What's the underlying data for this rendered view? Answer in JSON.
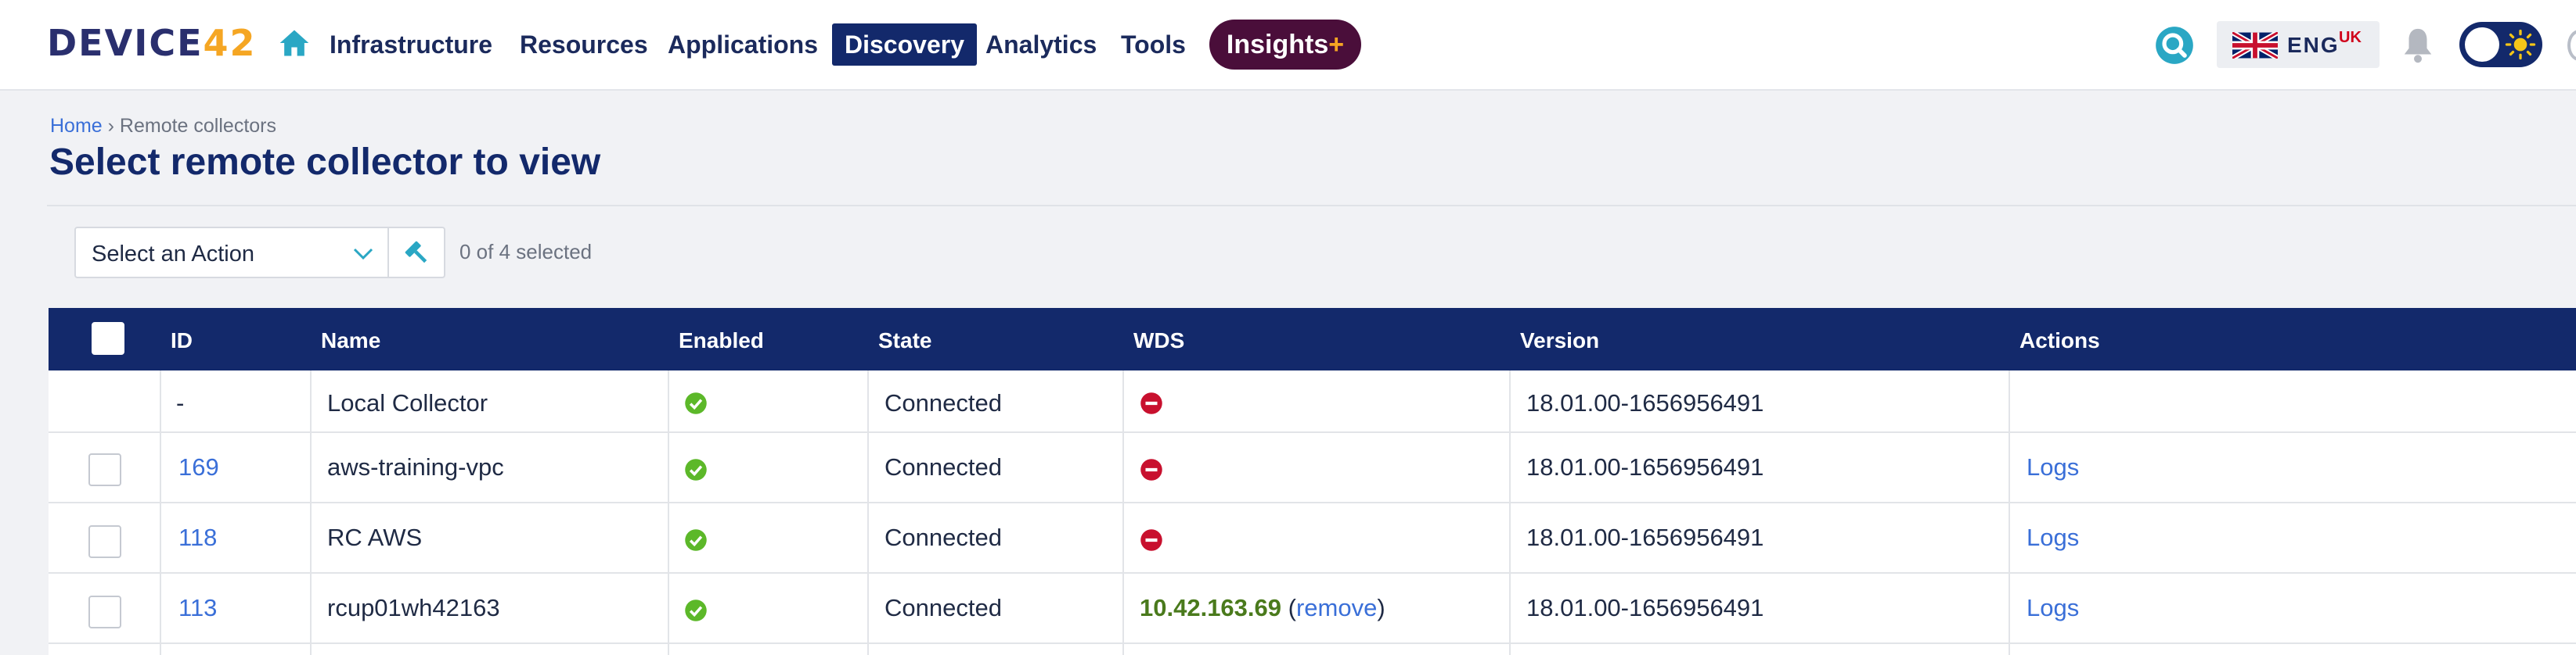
{
  "nav": {
    "logo_prefix": "DEVICE",
    "logo_number": "42",
    "items": [
      {
        "label": "Infrastructure"
      },
      {
        "label": "Resources"
      },
      {
        "label": "Applications"
      },
      {
        "label": "Discovery"
      },
      {
        "label": "Analytics"
      },
      {
        "label": "Tools"
      }
    ],
    "insights_label": "Insights",
    "insights_plus": "+",
    "language_code": "ENG",
    "language_region": "UK",
    "colors": {
      "primary": "#13296b",
      "insights": "#4a0e3a",
      "accent": "#f5a623",
      "search": "#2aa7c4"
    }
  },
  "breadcrumb": {
    "home": "Home",
    "separator": "›",
    "current": "Remote collectors"
  },
  "page": {
    "title": "Select remote collector to view"
  },
  "actions": {
    "select_label": "Select an Action",
    "selected_count": "0 of 4 selected"
  },
  "table": {
    "headers": {
      "id": "ID",
      "name": "Name",
      "enabled": "Enabled",
      "state": "State",
      "wds": "WDS",
      "version": "Version",
      "actions": "Actions"
    },
    "rows": [
      {
        "id": "-",
        "name": "Local Collector",
        "enabled": "enabled-check-icon",
        "state": "Connected",
        "wds": "disabled-icon",
        "version": "18.01.00-1656956491",
        "action": ""
      },
      {
        "id": "169",
        "name": "aws-training-vpc",
        "enabled": "enabled-check-icon",
        "state": "Connected",
        "wds": "disabled-icon",
        "version": "18.01.00-1656956491",
        "action": "Logs"
      },
      {
        "id": "118",
        "name": "RC AWS",
        "enabled": "enabled-check-icon",
        "state": "Connected",
        "wds": "disabled-icon",
        "version": "18.01.00-1656956491",
        "action": "Logs"
      },
      {
        "id": "113",
        "name": "rcup01wh42163",
        "enabled": "enabled-check-icon",
        "state": "Connected",
        "wds_ip": "10.42.163.69",
        "wds_open": "(",
        "wds_remove": "remove",
        "wds_close": ")",
        "version": "18.01.00-1656956491",
        "action": "Logs"
      }
    ]
  }
}
